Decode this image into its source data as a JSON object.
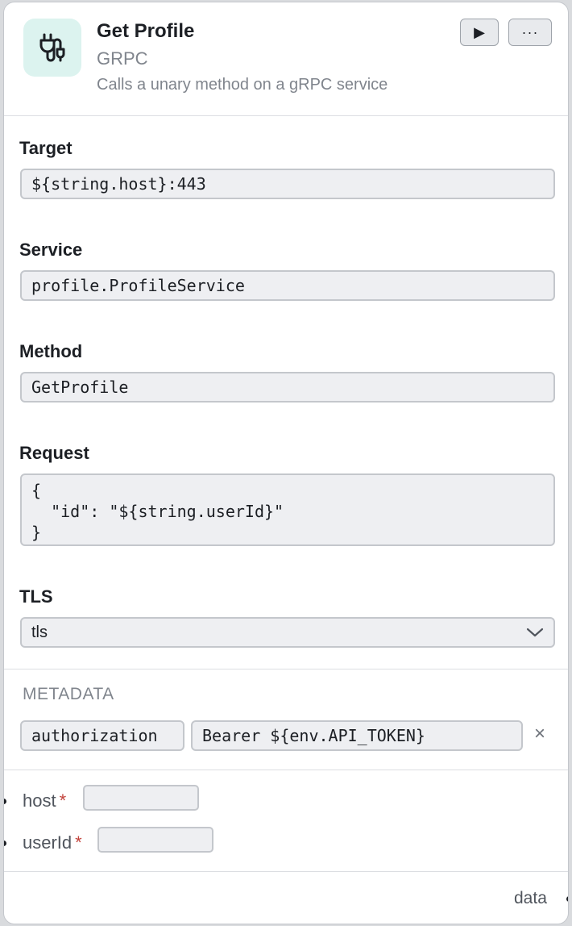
{
  "node": {
    "title": "Get Profile",
    "type": "GRPC",
    "description": "Calls a unary method on a gRPC service",
    "icon": "plug-icon",
    "accent": "#dcf3ef",
    "run_label": "▶",
    "more_label": "···"
  },
  "fields": {
    "target": {
      "label": "Target",
      "value": "${string.host}:443"
    },
    "service": {
      "label": "Service",
      "value": "profile.ProfileService"
    },
    "method": {
      "label": "Method",
      "value": "GetProfile"
    },
    "request": {
      "label": "Request",
      "value": "{\n  \"id\": \"${string.userId}\"\n}"
    },
    "tls": {
      "label": "TLS",
      "value": "tls"
    }
  },
  "metadata": {
    "title": "METADATA",
    "entries": [
      {
        "key": "authorization",
        "value": "Bearer ${env.API_TOKEN}"
      }
    ],
    "remove_label": "×"
  },
  "inputs": [
    {
      "name": "host",
      "required_mark": "*"
    },
    {
      "name": "userId",
      "required_mark": "*"
    }
  ],
  "output": {
    "name": "data"
  },
  "colors": {
    "required": "#c2433b",
    "muted": "#80858d"
  }
}
